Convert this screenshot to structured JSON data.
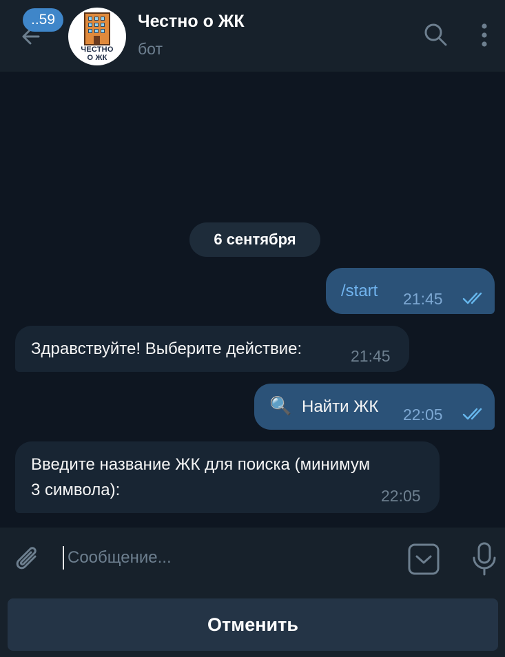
{
  "header": {
    "unread_count": "..59",
    "title": "Честно о ЖК",
    "status": "бот",
    "avatar_text_line1": "ЧЕСТНО",
    "avatar_text_line2": "О ЖК",
    "icons": [
      "back-arrow-icon",
      "search-icon",
      "more-vert-icon"
    ]
  },
  "messages": {
    "date_separator": "6 сентября",
    "items": [
      {
        "direction": "outgoing",
        "text": "/start",
        "time": "21:45",
        "read": true
      },
      {
        "direction": "incoming",
        "text": "Здравствуйте! Выберите действие:",
        "time": "21:45"
      },
      {
        "direction": "outgoing",
        "emoji": "🔍",
        "text": "Найти ЖК",
        "time": "22:05",
        "read": true
      },
      {
        "direction": "incoming",
        "text_line1": "Введите название ЖК для поиска (минимум",
        "text_line2": "3 символа):",
        "time": "22:05"
      }
    ]
  },
  "input": {
    "placeholder": "Сообщение...",
    "value": ""
  },
  "reply_keyboard": {
    "cancel_label": "Отменить"
  },
  "colors": {
    "background": "#0e1621",
    "header": "#17212b",
    "outgoing_bubble": "#2b5278",
    "incoming_bubble": "#182533",
    "accent": "#3f86c9",
    "link": "#71b4ef"
  }
}
